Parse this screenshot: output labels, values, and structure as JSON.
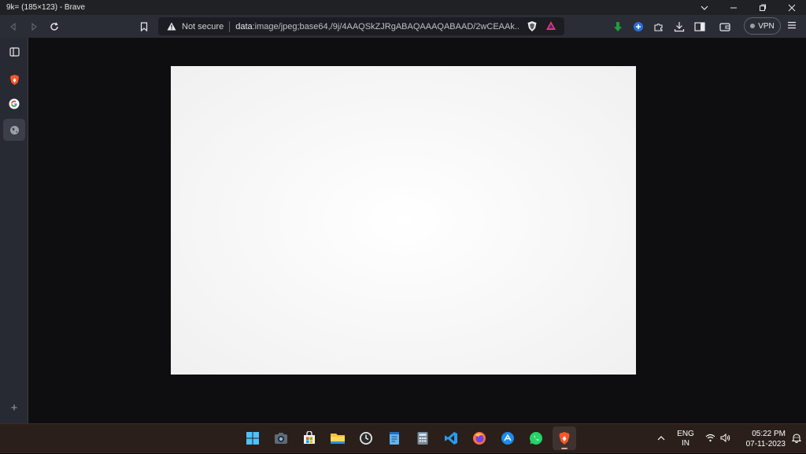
{
  "window": {
    "title": "9k= (185×123) - Brave",
    "controls": [
      "chevron-down-icon",
      "minimize-icon",
      "restore-icon",
      "close-icon"
    ]
  },
  "toolbar": {
    "security_label": "Not secure",
    "url_scheme": "data",
    "url_rest": ":image/jpeg;base64,/9j/4AAQSkZJRgABAQAAAQABAAD/2wCEAAk...",
    "vpn_label": "VPN"
  },
  "sidebar": {
    "items": [
      "sidebar-toggle-icon",
      "brave-icon",
      "google-icon",
      "globe-icon"
    ],
    "add_label": "+"
  },
  "content": {
    "image_description_visible": false
  },
  "taskbar": {
    "apps": [
      "windows-start",
      "camera",
      "microsoft-store",
      "file-explorer",
      "clock",
      "notepad",
      "calculator",
      "vscode",
      "firefox",
      "app-store-circle",
      "whatsapp",
      "brave"
    ],
    "language_line1": "ENG",
    "language_line2": "IN",
    "time": "05:22 PM",
    "date": "07-11-2023"
  },
  "colors": {
    "titlebar": "#202124",
    "toolbar": "#2b2d36",
    "sidebar": "#282a33",
    "content_bg": "#0e0e10",
    "taskbar": "#2a1f1b"
  }
}
